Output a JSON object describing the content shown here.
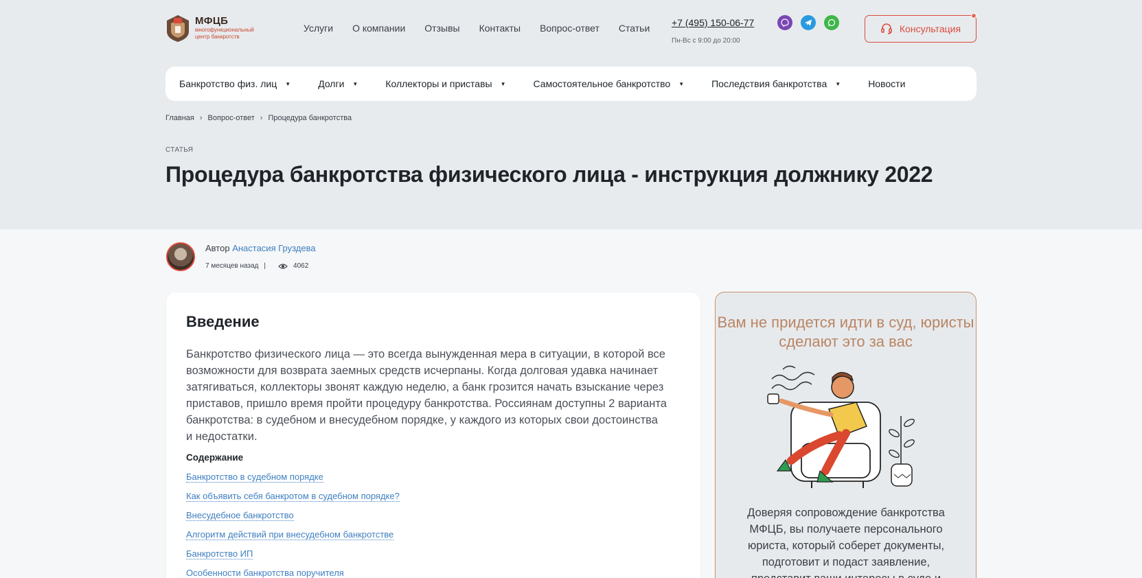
{
  "logo": {
    "name": "МФЦБ",
    "subtitle_line1": "многофункциональный",
    "subtitle_line2": "центр банкротств"
  },
  "topnav": [
    "Услуги",
    "О компании",
    "Отзывы",
    "Контакты",
    "Вопрос-ответ",
    "Статьи"
  ],
  "contact": {
    "phone": "+7 (495) 150-06-77",
    "hours": "Пн-Вс с 9:00 до 20:00"
  },
  "social": {
    "viber_icon": "viber-icon",
    "telegram_icon": "telegram-icon",
    "whatsapp_icon": "whatsapp-icon"
  },
  "consult_button": "Консультация",
  "mainnav": [
    {
      "label": "Банкротство физ. лиц",
      "has_dropdown": true
    },
    {
      "label": "Долги",
      "has_dropdown": true
    },
    {
      "label": "Коллекторы и приставы",
      "has_dropdown": true
    },
    {
      "label": "Самостоятельное банкротство",
      "has_dropdown": true
    },
    {
      "label": "Последствия банкротства",
      "has_dropdown": true
    },
    {
      "label": "Новости",
      "has_dropdown": false
    }
  ],
  "breadcrumbs": [
    "Главная",
    "Вопрос-ответ",
    "Процедура банкротства"
  ],
  "article": {
    "tag": "СТАТЬЯ",
    "title": "Процедура банкротства физического лица - инструкция должнику 2022",
    "author_prefix": "Автор",
    "author_name": "Анастасия Груздева",
    "published": "7 месяцев назад",
    "divider": "|",
    "views": "4062",
    "section_title": "Введение",
    "intro": "Банкротство физического лица — это всегда вынужденная мера в ситуации, в которой все возможности для возврата заемных средств исчерпаны. Когда долговая удавка начинает затягиваться, коллекторы звонят каждую неделю, а банк грозится начать взыскание через приставов, пришло время пройти процедуру банкротства. Россиянам доступны 2 варианта банкротства: в судебном и внесудебном порядке, у каждого из которых свои достоинства и недостатки.",
    "toc_title": "Содержание",
    "toc": [
      "Банкротство в судебном порядке",
      "Как объявить себя банкротом в судебном порядке?",
      "Внесудебное банкротство",
      "Алгоритм действий при внесудебном банкротстве",
      "Банкротство ИП",
      "Особенности банкротства поручителя"
    ]
  },
  "promo": {
    "title": "Вам не придется идти в суд, юристы сделают это за вас",
    "text": "Доверяя сопровождение банкротства МФЦБ, вы получаете персонального юриста, который соберет документы, подготовит и подаст заявление, представит ваши интересы в суде и"
  },
  "colors": {
    "accent": "#d94a3a",
    "link": "#3f7fc0",
    "promo_title": "#b98563",
    "hero_bg": "#e8ebee"
  }
}
